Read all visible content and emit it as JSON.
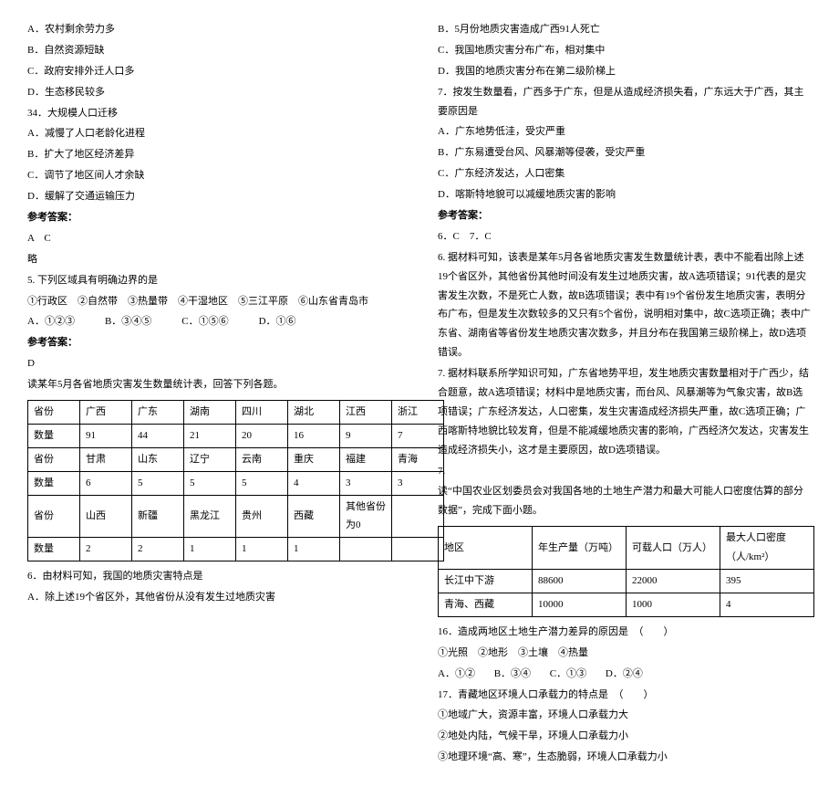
{
  "left": {
    "q33_opts": [
      "A．农村剩余劳力多",
      "B．自然资源短缺",
      "C．政府安排外迁人口多",
      "D．生态移民较多"
    ],
    "q34_stem": "34．大规模人口迁移",
    "q34_opts": [
      "A．减慢了人口老龄化进程",
      "B．扩大了地区经济差异",
      "C．调节了地区间人才余缺",
      "D．缓解了交通运输压力"
    ],
    "ans_label": "参考答案：",
    "ans_34": "A　C",
    "note_34": "略",
    "q5_stem": "5. 下列区域具有明确边界的是",
    "q5_items": "①行政区　②自然带　③热量带　④干湿地区　⑤三江平原　⑥山东省青岛市",
    "q5_opts": "A．①②③　　　B．③④⑤　　　C．①⑤⑥　　　D．①⑥",
    "ans_5": "D",
    "q6_intro": "读某年5月各省地质灾害发生数量统计表，回答下列各题。",
    "table1": {
      "rows": [
        [
          "省份",
          "广西",
          "广东",
          "湖南",
          "四川",
          "湖北",
          "江西",
          "浙江"
        ],
        [
          "数量",
          "91",
          "44",
          "21",
          "20",
          "16",
          "9",
          "7"
        ],
        [
          "省份",
          "甘肃",
          "山东",
          "辽宁",
          "云南",
          "重庆",
          "福建",
          "青海"
        ],
        [
          "数量",
          "6",
          "5",
          "5",
          "5",
          "4",
          "3",
          "3"
        ],
        [
          "省份",
          "山西",
          "新疆",
          "黑龙江",
          "贵州",
          "西藏",
          "其他省份为0",
          ""
        ],
        [
          "数量",
          "2",
          "2",
          "1",
          "1",
          "1",
          "",
          ""
        ]
      ]
    },
    "q6_stem": "6．由材料可知，我国的地质灾害特点是",
    "q6_optA": "A．除上述19个省区外，其他省份从没有发生过地质灾害"
  },
  "right": {
    "q6_opts_rest": [
      "B．5月份地质灾害造成广西91人死亡",
      "C．我国地质灾害分布广布，相对集中",
      "D．我国的地质灾害分布在第二级阶梯上"
    ],
    "q7_stem": "7．按发生数量看，广西多于广东，但是从造成经济损失看，广东远大于广西，其主要原因是",
    "q7_opts": [
      "A．广东地势低洼，受灾严重",
      "B．广东易遭受台风、风暴潮等侵袭，受灾严重",
      "C．广东经济发达，人口密集",
      "D．喀斯特地貌可以减缓地质灾害的影响"
    ],
    "ans_label": "参考答案：",
    "ans_67": "6．C　7．C",
    "exp6": "6. 据材料可知，该表是某年5月各省地质灾害发生数量统计表，表中不能看出除上述19个省区外，其他省份其他时间没有发生过地质灾害，故A选项错误；91代表的是灾害发生次数，不是死亡人数，故B选项错误；表中有19个省份发生地质灾害，表明分布广布，但是发生次数较多的又只有5个省份，说明相对集中，故C选项正确；表中广东省、湖南省等省份发生地质灾害次数多，并且分布在我国第三级阶梯上，故D选项错误。",
    "exp7": "7. 据材料联系所学知识可知，广东省地势平坦，发生地质灾害数量相对于广西少，结合题意，故A选项错误；材料中是地质灾害，而台风、风暴潮等为气象灾害，故B选项错误；广东经济发达，人口密集，发生灾害造成经济损失严重，故C选项正确；广西喀斯特地貌比较发育，但是不能减缓地质灾害的影响，广西经济欠发达，灾害发生造成经济损失小，这才是主要原因，故D选项错误。",
    "sec7": "7.",
    "sec7_intro": "读“中国农业区划委员会对我国各地的土地生产潜力和最大可能人口密度估算的部分数据”，完成下面小题。",
    "table2": {
      "header": [
        "地区",
        "年生产量（万吨）",
        "可载人口（万人）",
        "最大人口密度（人/km²）"
      ],
      "rows": [
        [
          "长江中下游",
          "88600",
          "22000",
          "395"
        ],
        [
          "青海、西藏",
          "10000",
          "1000",
          "4"
        ]
      ]
    },
    "q16_stem": "16．造成两地区土地生产潜力差异的原因是　（　　）",
    "q16_items": "①光照　②地形　③土壤　④热量",
    "q16_opts": [
      "A．①②",
      "B．③④",
      "C．①③",
      "D．②④"
    ],
    "q17_stem": "17．青藏地区环境人口承载力的特点是　（　　）",
    "q17_items": [
      "①地域广大，资源丰富，环境人口承载力大",
      "②地处内陆，气候干旱，环境人口承载力小",
      "③地理环境“高、寒”，生态脆弱，环境人口承载力小"
    ]
  }
}
